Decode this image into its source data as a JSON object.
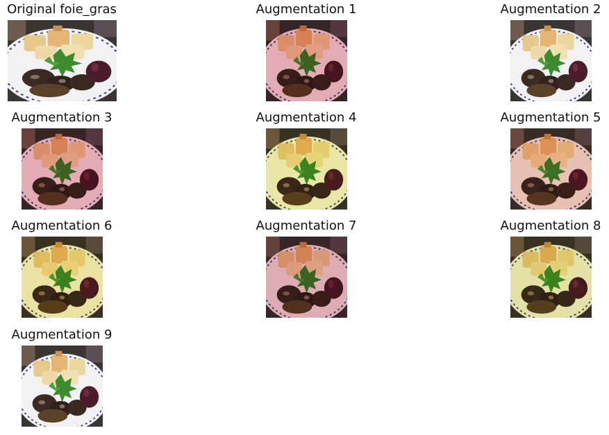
{
  "figure": {
    "panels": [
      {
        "title": "Original foie_gras",
        "tint": "none"
      },
      {
        "title": "Augmentation 1",
        "tint": "#d8384f"
      },
      {
        "title": "Augmentation 2",
        "tint": "none"
      },
      {
        "title": "Augmentation 3",
        "tint": "#d8384f"
      },
      {
        "title": "Augmentation 4",
        "tint": "#e6e02a"
      },
      {
        "title": "Augmentation 5",
        "tint": "#e8794a"
      },
      {
        "title": "Augmentation 6",
        "tint": "#ead21f"
      },
      {
        "title": "Augmentation 7",
        "tint": "#c8404a"
      },
      {
        "title": "Augmentation 8",
        "tint": "#d9d22a"
      },
      {
        "title": "Augmentation 9",
        "tint": "none"
      }
    ]
  }
}
